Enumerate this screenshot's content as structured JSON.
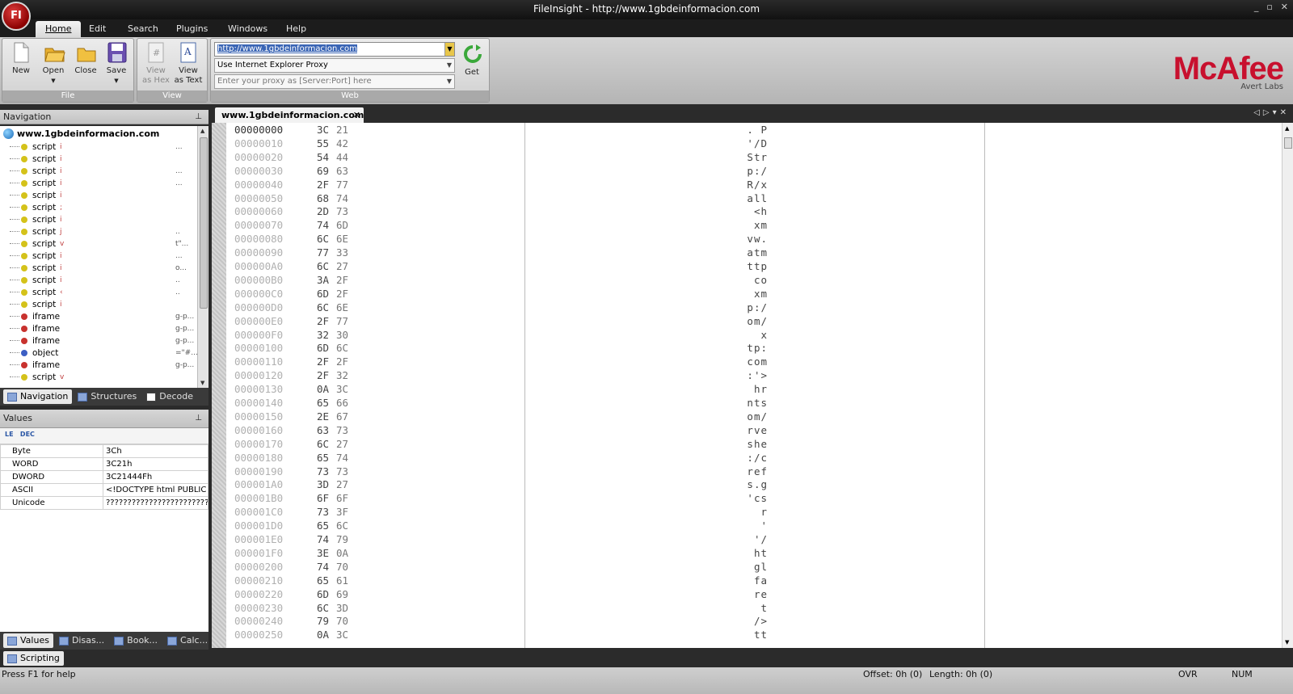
{
  "window": {
    "title": "FileInsight - http://www.1gbdeinformacion.com",
    "orb_label": "FI",
    "controls": [
      "_",
      "▫",
      "✕"
    ]
  },
  "menu": {
    "tabs": [
      "Home",
      "Edit",
      "Search",
      "Plugins",
      "Windows",
      "Help"
    ],
    "active": "Home"
  },
  "ribbon": {
    "file_group": {
      "label": "File",
      "new": "New",
      "open": "Open",
      "close": "Close",
      "save": "Save"
    },
    "view_group": {
      "label": "View",
      "view_hex": "View as Hex",
      "view_text": "View as Text"
    },
    "web_group": {
      "label": "Web",
      "url_value": "http://www.1gbdeinformacion.com",
      "proxy_mode": "Use Internet Explorer Proxy",
      "proxy_placeholder": "Enter your proxy as [Server:Port] here",
      "get": "Get"
    }
  },
  "brand": {
    "logo": "McAfee",
    "sub": "Avert Labs",
    "color": "#c8102e"
  },
  "navigation": {
    "title": "Navigation",
    "root": "www.1gbdeinformacion.com",
    "nodes": [
      {
        "label": "script",
        "frag": "i",
        "tail": "...",
        "color": "#d4c21a"
      },
      {
        "label": "script",
        "frag": "i",
        "tail": "",
        "color": "#d4c21a"
      },
      {
        "label": "script",
        "frag": "i",
        "tail": "...",
        "color": "#d4c21a"
      },
      {
        "label": "script",
        "frag": "i",
        "tail": "...",
        "color": "#d4c21a"
      },
      {
        "label": "script",
        "frag": "i",
        "tail": "",
        "color": "#d4c21a"
      },
      {
        "label": "script",
        "frag": ";",
        "tail": "",
        "color": "#d4c21a"
      },
      {
        "label": "script",
        "frag": "i",
        "tail": "",
        "color": "#d4c21a"
      },
      {
        "label": "script",
        "frag": "j",
        "tail": "..",
        "color": "#d4c21a"
      },
      {
        "label": "script",
        "frag": "v",
        "tail": "t\"...",
        "color": "#d4c21a"
      },
      {
        "label": "script",
        "frag": "i",
        "tail": "...",
        "color": "#d4c21a"
      },
      {
        "label": "script",
        "frag": "i",
        "tail": "o...",
        "color": "#d4c21a"
      },
      {
        "label": "script",
        "frag": "i",
        "tail": "..",
        "color": "#d4c21a"
      },
      {
        "label": "script",
        "frag": "‹",
        "tail": "..",
        "color": "#d4c21a"
      },
      {
        "label": "script",
        "frag": "i",
        "tail": "",
        "color": "#d4c21a"
      },
      {
        "label": "iframe",
        "frag": "",
        "tail": "g-p...",
        "color": "#c8322e"
      },
      {
        "label": "iframe",
        "frag": "",
        "tail": "g-p...",
        "color": "#c8322e"
      },
      {
        "label": "iframe",
        "frag": "",
        "tail": "g-p...",
        "color": "#c8322e"
      },
      {
        "label": "object",
        "frag": "",
        "tail": "=\"#...",
        "color": "#3c5fc4"
      },
      {
        "label": "iframe",
        "frag": "",
        "tail": "g-p...",
        "color": "#c8322e"
      },
      {
        "label": "script",
        "frag": "v",
        "tail": "",
        "color": "#d4c21a"
      }
    ],
    "tabs": [
      "Navigation",
      "Structures",
      "Decode"
    ]
  },
  "values": {
    "title": "Values",
    "toolbar": [
      "LE",
      "DEC"
    ],
    "rows": [
      {
        "name": "Byte",
        "value": "3Ch"
      },
      {
        "name": "WORD",
        "value": "3C21h"
      },
      {
        "name": "DWORD",
        "value": "3C21444Fh"
      },
      {
        "name": "ASCII",
        "value": "<!DOCTYPE html PUBLIC \"-..."
      },
      {
        "name": "Unicode",
        "value": "??????????????????????????"
      }
    ],
    "tabs": [
      "Values",
      "Disas...",
      "Book...",
      "Calc..."
    ]
  },
  "document": {
    "tab": "www.1gbdeinformacion.com",
    "close": "✕",
    "rows": [
      {
        "off": "00000000",
        "b1": "3C",
        "b2": "21",
        "asc": ". P"
      },
      {
        "off": "00000010",
        "b1": "55",
        "b2": "42",
        "asc": "'/D"
      },
      {
        "off": "00000020",
        "b1": "54",
        "b2": "44",
        "asc": "Str"
      },
      {
        "off": "00000030",
        "b1": "69",
        "b2": "63",
        "asc": "p:/"
      },
      {
        "off": "00000040",
        "b1": "2F",
        "b2": "77",
        "asc": "R/x"
      },
      {
        "off": "00000050",
        "b1": "68",
        "b2": "74",
        "asc": "all"
      },
      {
        "off": "00000060",
        "b1": "2D",
        "b2": "73",
        "asc": "<h"
      },
      {
        "off": "00000070",
        "b1": "74",
        "b2": "6D",
        "asc": "xm"
      },
      {
        "off": "00000080",
        "b1": "6C",
        "b2": "6E",
        "asc": "vw."
      },
      {
        "off": "00000090",
        "b1": "77",
        "b2": "33",
        "asc": "atm"
      },
      {
        "off": "000000A0",
        "b1": "6C",
        "b2": "27",
        "asc": "ttp"
      },
      {
        "off": "000000B0",
        "b1": "3A",
        "b2": "2F",
        "asc": "co"
      },
      {
        "off": "000000C0",
        "b1": "6D",
        "b2": "2F",
        "asc": "xm"
      },
      {
        "off": "000000D0",
        "b1": "6C",
        "b2": "6E",
        "asc": "p:/"
      },
      {
        "off": "000000E0",
        "b1": "2F",
        "b2": "77",
        "asc": "om/"
      },
      {
        "off": "000000F0",
        "b1": "32",
        "b2": "30",
        "asc": "x"
      },
      {
        "off": "00000100",
        "b1": "6D",
        "b2": "6C",
        "asc": "tp:"
      },
      {
        "off": "00000110",
        "b1": "2F",
        "b2": "2F",
        "asc": "com"
      },
      {
        "off": "00000120",
        "b1": "2F",
        "b2": "32",
        "asc": ":'>"
      },
      {
        "off": "00000130",
        "b1": "0A",
        "b2": "3C",
        "asc": "hr"
      },
      {
        "off": "00000140",
        "b1": "65",
        "b2": "66",
        "asc": "nts"
      },
      {
        "off": "00000150",
        "b1": "2E",
        "b2": "67",
        "asc": "om/"
      },
      {
        "off": "00000160",
        "b1": "63",
        "b2": "73",
        "asc": "rve"
      },
      {
        "off": "00000170",
        "b1": "6C",
        "b2": "27",
        "asc": "she"
      },
      {
        "off": "00000180",
        "b1": "65",
        "b2": "74",
        "asc": ":/c"
      },
      {
        "off": "00000190",
        "b1": "73",
        "b2": "73",
        "asc": "ref"
      },
      {
        "off": "000001A0",
        "b1": "3D",
        "b2": "27",
        "asc": "s.g"
      },
      {
        "off": "000001B0",
        "b1": "6F",
        "b2": "6F",
        "asc": "'cs"
      },
      {
        "off": "000001C0",
        "b1": "73",
        "b2": "3F",
        "asc": "r"
      },
      {
        "off": "000001D0",
        "b1": "65",
        "b2": "6C",
        "asc": "'"
      },
      {
        "off": "000001E0",
        "b1": "74",
        "b2": "79",
        "asc": "'/"
      },
      {
        "off": "000001F0",
        "b1": "3E",
        "b2": "0A",
        "asc": "ht"
      },
      {
        "off": "00000200",
        "b1": "74",
        "b2": "70",
        "asc": "gl"
      },
      {
        "off": "00000210",
        "b1": "65",
        "b2": "61",
        "asc": "fa"
      },
      {
        "off": "00000220",
        "b1": "6D",
        "b2": "69",
        "asc": "re"
      },
      {
        "off": "00000230",
        "b1": "6C",
        "b2": "3D",
        "asc": "t"
      },
      {
        "off": "00000240",
        "b1": "79",
        "b2": "70",
        "asc": "/>"
      },
      {
        "off": "00000250",
        "b1": "0A",
        "b2": "3C",
        "asc": "tt"
      }
    ]
  },
  "scripting": {
    "tab": "Scripting"
  },
  "status": {
    "help": "Press F1 for help",
    "offset": "Offset: 0h (0)",
    "length": "Length: 0h (0)",
    "ovr": "OVR",
    "num": "NUM"
  }
}
